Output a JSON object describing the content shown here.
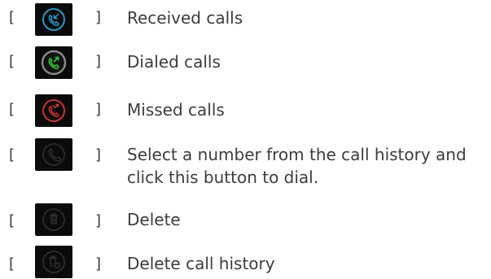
{
  "legend_items": [
    {
      "icon": "received-calls-icon",
      "color": "#1ea7de",
      "label": "Received calls"
    },
    {
      "icon": "dialed-calls-icon",
      "color": "#2ecb33",
      "label": "Dialed calls"
    },
    {
      "icon": "missed-calls-icon",
      "color": "#e0352b",
      "label": "Missed calls"
    },
    {
      "icon": "dial-icon",
      "color": "#2c2c2c",
      "label_line1": "Select a number from the call history and",
      "label_line2": "click this button to dial."
    },
    {
      "icon": "delete-icon",
      "color": "#2c2c2c",
      "label": "Delete"
    },
    {
      "icon": "delete-call-history-icon",
      "color": "#2c2c2c",
      "label": "Delete call history"
    }
  ],
  "brackets": {
    "open": "[",
    "close": "]"
  }
}
